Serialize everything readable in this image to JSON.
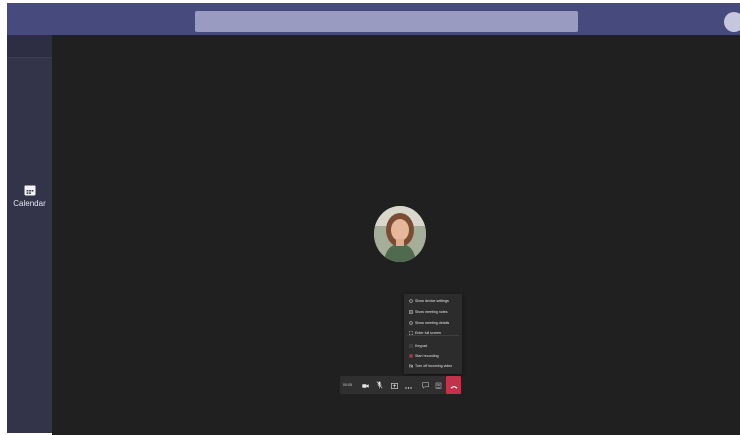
{
  "app": {
    "search_placeholder": "",
    "accent_color": "#464775",
    "stage_color": "#202020",
    "hangup_color": "#c4314b"
  },
  "sidebar": {
    "items": [
      {
        "label": "Calendar",
        "icon": "calendar-icon"
      }
    ]
  },
  "meeting": {
    "timer": "00:05",
    "participant_avatar": "participant-photo",
    "more_actions_menu": [
      {
        "label": "Show device settings",
        "icon": "gear-icon"
      },
      {
        "label": "Show meeting notes",
        "icon": "notes-icon"
      },
      {
        "label": "Show meeting details",
        "icon": "info-icon"
      },
      {
        "label": "Enter full screen",
        "icon": "fullscreen-icon"
      },
      {
        "label": "Keypad",
        "icon": "keypad-icon"
      },
      {
        "label": "Start recording",
        "icon": "record-icon"
      },
      {
        "label": "Turn off incoming video",
        "icon": "video-off-icon"
      }
    ],
    "controls": [
      {
        "name": "camera",
        "icon": "camera-icon"
      },
      {
        "name": "microphone",
        "icon": "mic-muted-icon"
      },
      {
        "name": "share",
        "icon": "share-screen-icon"
      },
      {
        "name": "more",
        "icon": "more-icon"
      },
      {
        "name": "chat",
        "icon": "chat-icon"
      },
      {
        "name": "participants",
        "icon": "people-icon"
      },
      {
        "name": "hang-up",
        "icon": "hang-up-icon"
      }
    ]
  }
}
